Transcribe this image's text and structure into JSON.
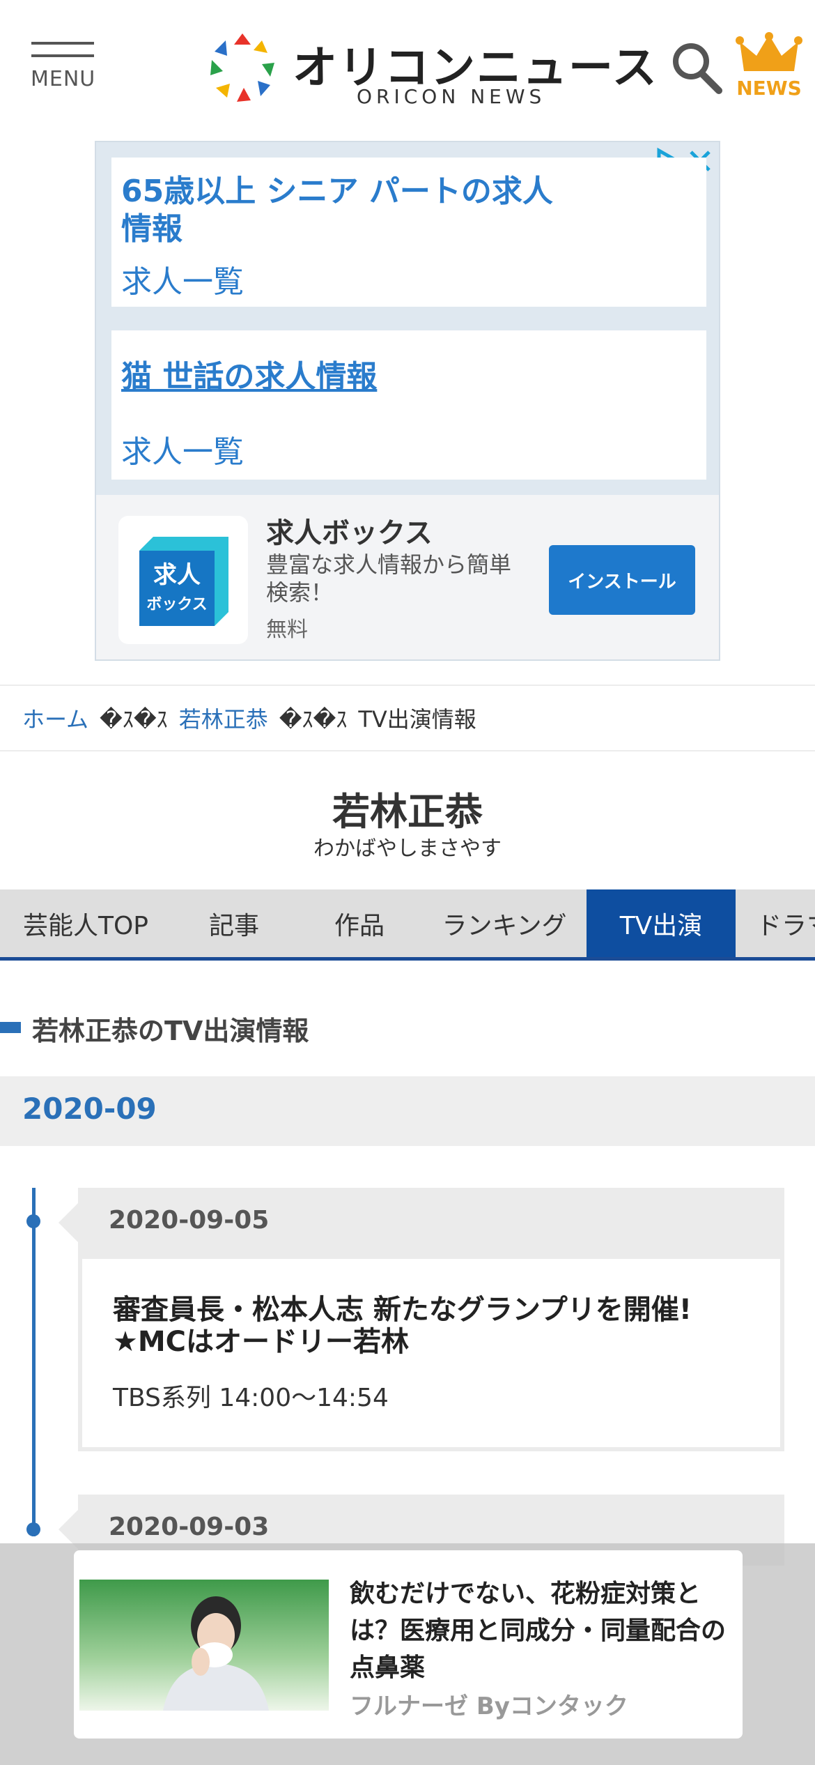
{
  "header": {
    "menu_label": "MENU",
    "logo_text": "オリコンニュース",
    "logo_sub": "ORICON NEWS",
    "news_label": "NEWS",
    "accent_color": "#f0a018"
  },
  "ad": {
    "card1_title": "65歳以上 シニア パートの求人情報",
    "card1_link": "求人一覧",
    "card2_title": "猫 世話の求人情報",
    "card2_link": "求人一覧",
    "app_icon_line1": "求人",
    "app_icon_line2": "ボックス",
    "app_name": "求人ボックス",
    "app_desc": "豊富な求人情報から簡単検索！",
    "app_price": "無料",
    "install_label": "インストール"
  },
  "breadcrumb": {
    "home": "ホーム",
    "separator": "�ｽ�ｽ",
    "person": "若林正恭",
    "current": "TV出演情報"
  },
  "person": {
    "name": "若林正恭",
    "kana": "わかばやしまさやす"
  },
  "tabs": [
    {
      "label": "芸能人TOP"
    },
    {
      "label": "記事"
    },
    {
      "label": "作品"
    },
    {
      "label": "ランキング"
    },
    {
      "label": "TV出演"
    },
    {
      "label": "ドラマ"
    }
  ],
  "section_title": "若林正恭のTV出演情報",
  "month": "2020-09",
  "entries": [
    {
      "date": "2020-09-05",
      "title": "審査員長・松本人志 新たなグランプリを開催!★MCはオードリー若林",
      "channel": "TBS系列 14:00〜14:54"
    },
    {
      "date": "2020-09-03"
    }
  ],
  "overlay_ad": {
    "title": "飲むだけでない、花粉症対策とは？医療用と同成分・同量配合の点鼻薬",
    "sponsor": "フルナーゼ Byコンタック"
  },
  "colors": {
    "link": "#2a70b8",
    "tab_active": "#0e4ea0",
    "ad_link": "#2a7ccc"
  }
}
